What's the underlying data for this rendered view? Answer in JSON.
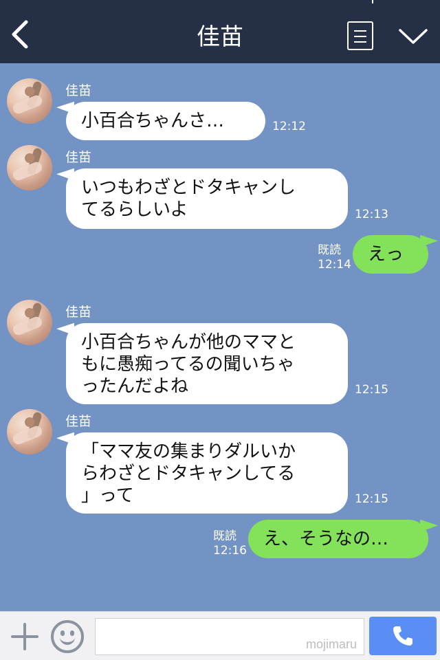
{
  "header": {
    "title": "佳苗"
  },
  "messages": [
    {
      "side": "in",
      "sender": "佳苗",
      "lines": [
        "小百合ちゃんさ…"
      ],
      "time": "12:12"
    },
    {
      "side": "in",
      "sender": "佳苗",
      "lines": [
        "いつもわざとドタキャンし",
        "てるらしいよ"
      ],
      "time": "12:13"
    },
    {
      "side": "out",
      "lines": [
        "えっ"
      ],
      "read": "既読",
      "time": "12:14"
    },
    {
      "side": "in",
      "sender": "佳苗",
      "lines": [
        "小百合ちゃんが他のママと",
        "もに愚痴ってるの聞いちゃ",
        "ったんだよね"
      ],
      "time": "12:15"
    },
    {
      "side": "in",
      "sender": "佳苗",
      "lines": [
        "「ママ友の集まりダルいか",
        "らわざとドタキャンしてる",
        "」って"
      ],
      "time": "12:15"
    },
    {
      "side": "out",
      "lines": [
        "え、そうなの…"
      ],
      "read": "既読",
      "time": "12:16"
    }
  ],
  "input": {
    "watermark": "mojimaru"
  },
  "icons": {
    "back": "chevron-left-icon",
    "menu": "notes-icon",
    "collapse": "chevron-down-icon",
    "plus": "plus-icon",
    "emoji": "smiley-icon",
    "call": "phone-icon"
  },
  "colors": {
    "header": "#253046",
    "background": "#7293c3",
    "incoming": "#ffffff",
    "outgoing": "#84e15a",
    "call_button": "#5b8ef5"
  }
}
